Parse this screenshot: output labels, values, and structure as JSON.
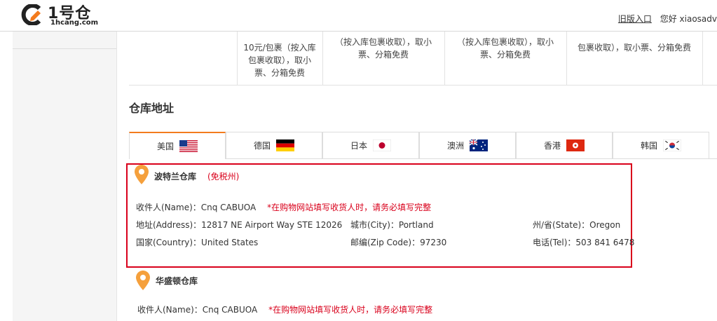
{
  "header": {
    "logo_text": "1号仓",
    "logo_sub": "1hcang.com",
    "old_version_link": "旧版入口",
    "greeting": "您好 xiaosadv"
  },
  "fee_table": {
    "columns": [
      {
        "lines": [
          "10元/包裹（按入库",
          "包裹收取），取小",
          "票、分箱免费"
        ]
      },
      {
        "lines": [
          "（按入库包裹收取），取小",
          "票、分箱免费"
        ]
      },
      {
        "lines": [
          "（按入库包裹收取），取小",
          "票、分箱免费"
        ]
      },
      {
        "lines": [
          "包裹收取），取小票、分箱免费"
        ]
      }
    ]
  },
  "section_title": "仓库地址",
  "tabs": [
    {
      "label": "美国",
      "flag": "us-flag-icon"
    },
    {
      "label": "德国",
      "flag": "de-flag-icon"
    },
    {
      "label": "日本",
      "flag": "jp-flag-icon"
    },
    {
      "label": "澳洲",
      "flag": "au-flag-icon"
    },
    {
      "label": "香港",
      "flag": "hk-flag-icon"
    },
    {
      "label": "韩国",
      "flag": "kr-flag-icon"
    }
  ],
  "warehouses": [
    {
      "name": "波特兰仓库",
      "tag": "(免税州)",
      "recipient": "收件人(Name)：Cnq CABUOA",
      "notice": "*在购物网站填写收货人时，请务必填写完整",
      "address": "地址(Address)：12817 NE Airport Way STE 12026",
      "city": "城市(City)：Portland",
      "state": "州/省(State)：Oregon",
      "country": "国家(Country)：United States",
      "zip": "邮编(Zip Code)：97230",
      "tel": "电话(Tel)：503 841 6478"
    },
    {
      "name": "华盛顿仓库",
      "recipient": "收件人(Name)：Cnq CABUOA",
      "notice": "*在购物网站填写收货人时，请务必填写完整"
    }
  ],
  "colors": {
    "accent": "#f37b1d",
    "highlight": "#d9001b",
    "pin": "#f5a03c"
  }
}
